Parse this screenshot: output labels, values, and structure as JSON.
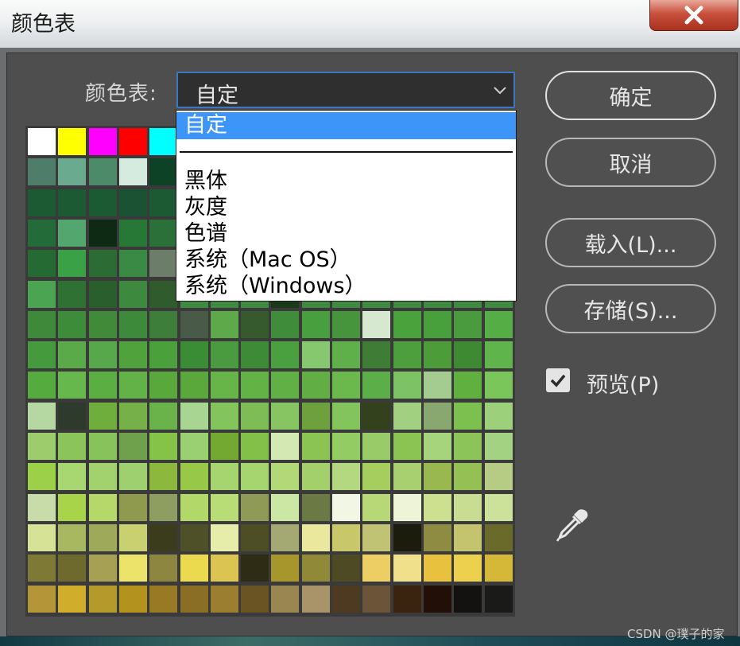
{
  "window": {
    "title": "颜色表",
    "close_label": "x"
  },
  "color_table": {
    "label": "颜色表:",
    "select_value": "自定",
    "options": [
      "自定",
      "",
      "黑体",
      "灰度",
      "色谱",
      "系统（Mac OS）",
      "系统（Windows）"
    ],
    "selected_index": 0
  },
  "swatches": [
    [
      "#ffffff",
      "#ffff00",
      "#ff00ff",
      "#ff0000",
      "#00ffff",
      "#1d5a3b",
      "#1b5a38",
      "#1b5733",
      "#1e5a35",
      "#1a5634",
      "#1a5533",
      "#1d5a36",
      "#1f5d37",
      "#1b5735",
      "#1b5634",
      "#1a5a34"
    ],
    [
      "#4e7e6a",
      "#6aaa8e",
      "#4d8a6a",
      "#d6ebe0",
      "#0d4226",
      "#185a34",
      "#1c5a35",
      "#1d5b35",
      "#1c5a35",
      "#1b5835",
      "#1c5a35",
      "#1b5935",
      "#1c5a35",
      "#1b5935",
      "#1b5935",
      "#1c5a35"
    ],
    [
      "#1b5a33",
      "#1b5a33",
      "#1b5a33",
      "#1b5233",
      "#1b5a33",
      "#1f5a35",
      "#1f5b37",
      "#1f5b37",
      "#1f5b37",
      "#1f5b37",
      "#1f5b37",
      "#1f5b37",
      "#1f5b37",
      "#1f5b37",
      "#1f5b37",
      "#1f5b37"
    ],
    [
      "#236b38",
      "#52a66e",
      "#0e2a14",
      "#277836",
      "#2b7038",
      "#276a36",
      "#276a36",
      "#276a36",
      "#276a36",
      "#276a36",
      "#276a36",
      "#276a36",
      "#276a36",
      "#276a36",
      "#276a36",
      "#276a36"
    ],
    [
      "#256a32",
      "#3aa147",
      "#2d6b34",
      "#3a8a46",
      "#6c7d6a",
      "#2d7135",
      "#2d7135",
      "#2d7135",
      "#2d7135",
      "#2d7135",
      "#2d7135",
      "#2d7135",
      "#2d7135",
      "#2d7135",
      "#2d7135",
      "#2d7135"
    ],
    [
      "#4aa452",
      "#2f7133",
      "#2a5f2d",
      "#3d8a3f",
      "#2f5b2d",
      "#3d8a40",
      "#3d8a40",
      "#3d8a40",
      "#1a3a1a",
      "#3d8a40",
      "#3d8a40",
      "#3d8a40",
      "#3d8a40",
      "#3d8a40",
      "#3d8a40",
      "#3d8a40"
    ],
    [
      "#3e8a3a",
      "#3c8c3a",
      "#408a3a",
      "#3d8a3a",
      "#3d7e3a",
      "#4a5a48",
      "#5eaa4a",
      "#365a2e",
      "#3f8d3a",
      "#47a03d",
      "#46953c",
      "#d6e8cf",
      "#4aa23c",
      "#47a03c",
      "#4a9a3e",
      "#54ad45"
    ],
    [
      "#459a3d",
      "#5aaa4a",
      "#56a84b",
      "#4fa23c",
      "#4aa03a",
      "#3a8d34",
      "#4a9a40",
      "#3e8b37",
      "#4aa03f",
      "#86c86e",
      "#5fb04a",
      "#3f7d37",
      "#4d9f3e",
      "#4c9c3a",
      "#3e8a33",
      "#5fb54c"
    ],
    [
      "#56ab3f",
      "#66b74c",
      "#5aae42",
      "#63b248",
      "#58a83c",
      "#5aa83c",
      "#67b548",
      "#63b246",
      "#60b046",
      "#60ae44",
      "#6bb84c",
      "#5cae48",
      "#7dc264",
      "#a4cc91",
      "#5fb03e",
      "#7ac65a"
    ],
    [
      "#b5d8a2",
      "#2e3a2c",
      "#6fae3c",
      "#75b048",
      "#6ab24a",
      "#a9d592",
      "#84c45c",
      "#7ebd55",
      "#87c462",
      "#6ea03e",
      "#84c45c",
      "#33421c",
      "#a2d081",
      "#89a870",
      "#7cc050",
      "#9cd07a"
    ],
    [
      "#9ccc6c",
      "#8ac45a",
      "#88c25a",
      "#6fa04c",
      "#84c248",
      "#9bd072",
      "#73a831",
      "#82c04a",
      "#d4e8b4",
      "#8cc454",
      "#93cc62",
      "#99cc69",
      "#8cc454",
      "#a6d47c",
      "#8dc45a",
      "#a2d282"
    ],
    [
      "#9cd048",
      "#a8d670",
      "#a2d26e",
      "#9ed070",
      "#8cb83e",
      "#97c848",
      "#a6d46e",
      "#a6d46e",
      "#b2d878",
      "#a4d06c",
      "#b4d880",
      "#a6ce5e",
      "#a8d070",
      "#99b850",
      "#94c054",
      "#b6cc84"
    ],
    [
      "#c8dcaa",
      "#a8d44a",
      "#b6d86a",
      "#909a4e",
      "#8e9e60",
      "#b2d86a",
      "#b8dc76",
      "#8e9a56",
      "#cce6a4",
      "#6b7a44",
      "#f2f6e4",
      "#b8d878",
      "#eef4d8",
      "#cce090",
      "#c8dc92",
      "#cce19a"
    ],
    [
      "#d6e296",
      "#a8b860",
      "#9eaa5a",
      "#c8d070",
      "#3a3c1c",
      "#4e5028",
      "#e6ecaa",
      "#4e4e26",
      "#a4a872",
      "#eae89c",
      "#c8c86a",
      "#c0c274",
      "#1c1c0c",
      "#8e8c42",
      "#c4c46e",
      "#6a6a2a"
    ],
    [
      "#7e7a36",
      "#6e6a2e",
      "#a6a054",
      "#ece46a",
      "#8c8640",
      "#ecda4e",
      "#dcc452",
      "#2e2c14",
      "#a6962c",
      "#908a38",
      "#4e4a24",
      "#ecce64",
      "#f0e08c",
      "#e8c23e",
      "#ecd04e",
      "#d6b838"
    ],
    [
      "#b49638",
      "#d0ae2c",
      "#b49a2a",
      "#b4921e",
      "#987a24",
      "#8a6e26",
      "#9c7e30",
      "#6a5424",
      "#9a8650",
      "#a89468",
      "#4e3a20",
      "#6c5438",
      "#3a2410",
      "#221008",
      "#141210",
      "#1a1a18"
    ]
  ],
  "buttons": {
    "ok": "确定",
    "cancel": "取消",
    "load": "载入(L)...",
    "save": "存储(S)..."
  },
  "preview": {
    "label": "预览(P)",
    "checked": true
  },
  "watermark": "CSDN @璞子的家"
}
